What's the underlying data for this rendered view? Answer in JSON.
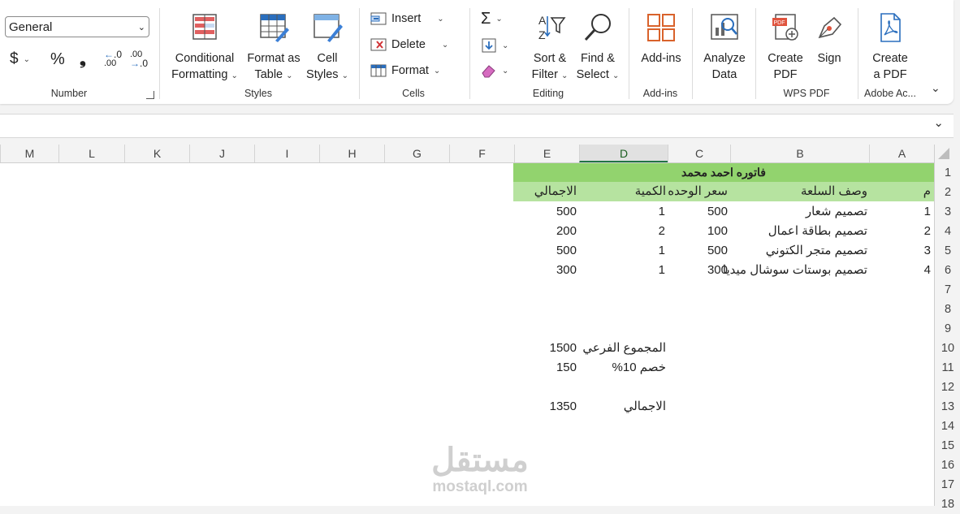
{
  "ribbon": {
    "number": {
      "format_value": "General",
      "currency_symbol": "$",
      "percent_symbol": "%",
      "comma_symbol": "❟",
      "inc_decimal_label": ".00",
      "dec_decimal_label": ".00",
      "group_label": "Number"
    },
    "styles": {
      "conditional_formatting": [
        "Conditional",
        "Formatting"
      ],
      "format_as_table": [
        "Format as",
        "Table"
      ],
      "cell_styles": [
        "Cell",
        "Styles"
      ],
      "group_label": "Styles"
    },
    "cells": {
      "insert": "Insert",
      "delete": "Delete",
      "format": "Format",
      "group_label": "Cells"
    },
    "editing": {
      "sort_filter": [
        "Sort &",
        "Filter"
      ],
      "find_select": [
        "Find &",
        "Select"
      ],
      "group_label": "Editing"
    },
    "addins": {
      "addins": "Add-ins",
      "analyze_data": [
        "Analyze",
        "Data"
      ],
      "group_label": "Add-ins"
    },
    "wps": {
      "create_pdf": [
        "Create",
        "PDF"
      ],
      "sign": "Sign",
      "group_label": "WPS PDF"
    },
    "adobe": {
      "create_pdf": [
        "Create",
        "a PDF"
      ],
      "group_label": "Adobe Ac..."
    }
  },
  "columns": [
    "M",
    "L",
    "K",
    "J",
    "I",
    "H",
    "G",
    "F",
    "E",
    "D",
    "C",
    "B",
    "A"
  ],
  "selected_column": "D",
  "rows": [
    "1",
    "2",
    "3",
    "4",
    "5",
    "6",
    "7",
    "8",
    "9",
    "10",
    "11",
    "12",
    "13",
    "14",
    "15",
    "16",
    "17",
    "18"
  ],
  "sheet": {
    "title": "فاتوره احمد محمد",
    "headers": {
      "num": "م",
      "desc": "وصف السلعة",
      "unit_price": "سعر الوحده",
      "qty": "الكمية",
      "total": "الاجمالي"
    },
    "items": [
      {
        "num": "1",
        "desc": "تصميم شعار",
        "unit_price": "500",
        "qty": "1",
        "total": "500"
      },
      {
        "num": "2",
        "desc": "تصميم بطاقة اعمال",
        "unit_price": "100",
        "qty": "2",
        "total": "200"
      },
      {
        "num": "3",
        "desc": "تصميم متجر الكتوني",
        "unit_price": "500",
        "qty": "1",
        "total": "500"
      },
      {
        "num": "4",
        "desc": "تصميم بوستات سوشال ميديا",
        "unit_price": "300",
        "qty": "1",
        "total": "300"
      }
    ],
    "subtotal_label": "المجموع الفرعي",
    "subtotal_value": "1500",
    "discount_label": "خصم 10%",
    "discount_value": "150",
    "grand_total_label": "الاجمالي",
    "grand_total_value": "1350"
  },
  "watermark": {
    "arabic": "مستقل",
    "latin": "mostaql.com"
  }
}
